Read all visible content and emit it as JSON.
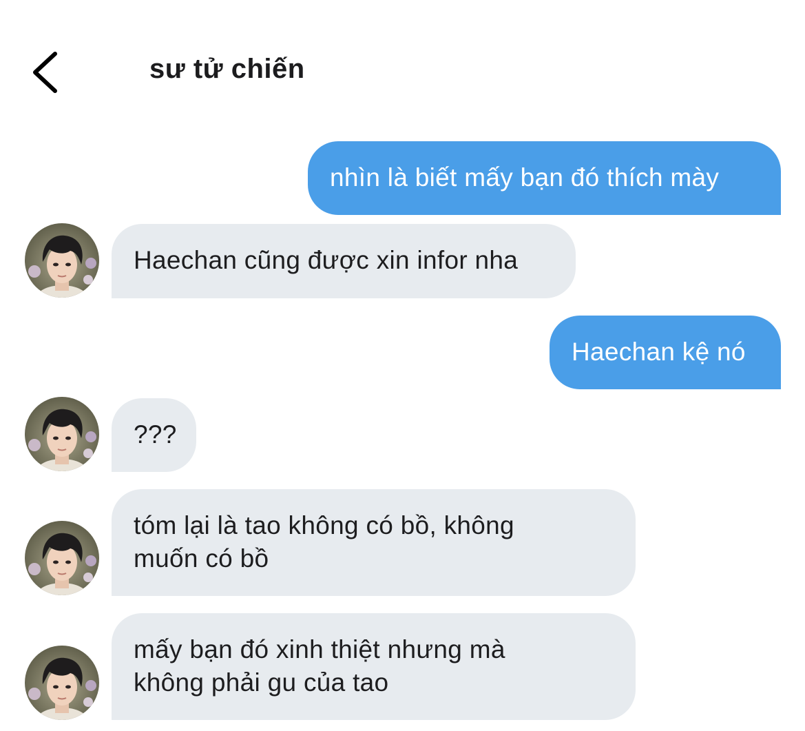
{
  "header": {
    "title": "sư tử chiến",
    "back_icon": "chevron-left-icon"
  },
  "messages": [
    {
      "direction": "sent",
      "text": "nhìn là biết mấy bạn đó thích mày"
    },
    {
      "direction": "received",
      "text": "Haechan cũng được xin infor nha"
    },
    {
      "direction": "sent",
      "text": "Haechan kệ nó"
    },
    {
      "direction": "received",
      "text": "???"
    },
    {
      "direction": "received",
      "lines": [
        "tóm lại là tao không có bồ, không",
        "muốn có bồ"
      ]
    },
    {
      "direction": "received",
      "lines": [
        "mấy bạn đó xinh thiệt nhưng mà",
        "không phải gu của tao"
      ]
    }
  ],
  "colors": {
    "sent_bubble": "#4a9ee8",
    "received_bubble": "#e7ebef",
    "text_dark": "#1d1d1f"
  }
}
